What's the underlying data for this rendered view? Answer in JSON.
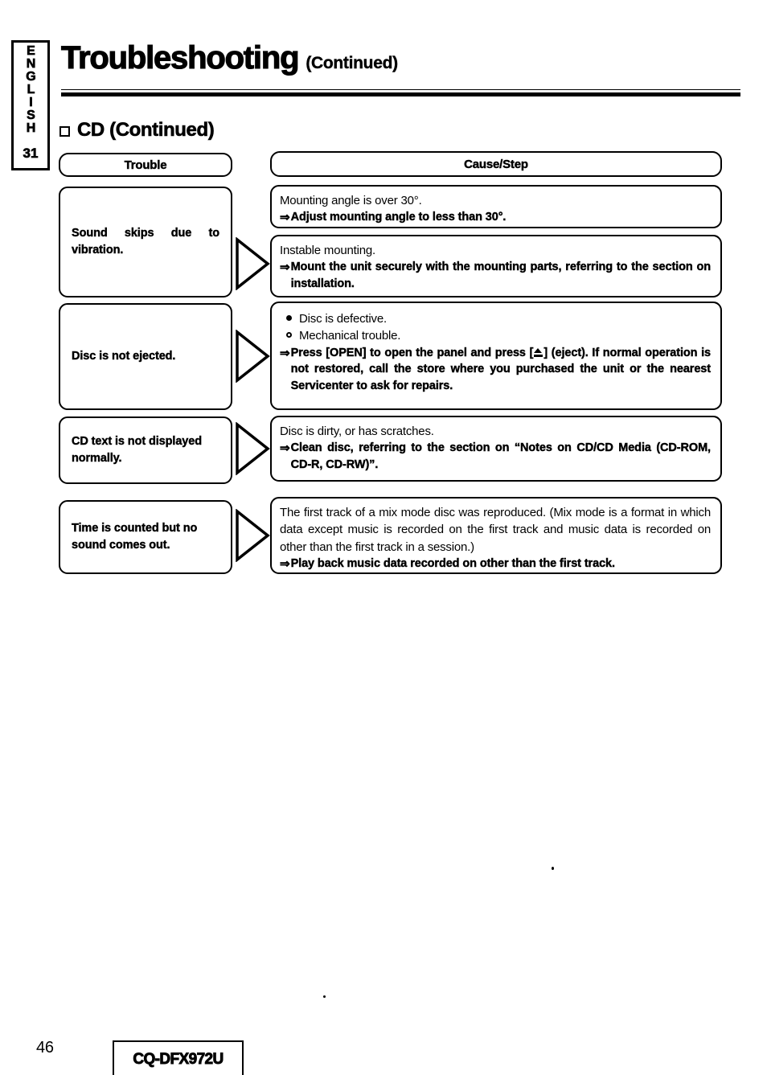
{
  "sidebar": {
    "language_tab": "ENGLISH",
    "tab_number": "31"
  },
  "header": {
    "title": "Troubleshooting",
    "title_suffix": "(Continued)"
  },
  "section": {
    "bullet_icon": "open-square-bullet",
    "heading": "CD (Continued)"
  },
  "table": {
    "columns": {
      "trouble": "Trouble",
      "cause_step": "Cause/Step"
    },
    "rows": [
      {
        "trouble": "Sound skips due to vibration.",
        "arrow_icon": "triangle-right-icon",
        "causes": [
          {
            "lines": [
              {
                "style": "plain",
                "text": "Mounting angle is over 30°."
              }
            ],
            "steps": [
              {
                "arrow": "⇒",
                "text": "Adjust mounting angle to less than 30°."
              }
            ]
          },
          {
            "lines": [
              {
                "style": "plain",
                "text": "Instable mounting."
              }
            ],
            "steps": [
              {
                "arrow": "⇒",
                "text": "Mount the unit securely with the mounting parts, referring to the section on installation."
              }
            ]
          }
        ]
      },
      {
        "trouble": "Disc is not ejected.",
        "arrow_icon": "triangle-right-icon",
        "causes": [
          {
            "bullets": [
              {
                "marker": "filled-ring",
                "text": "Disc is defective."
              },
              {
                "marker": "open-ring",
                "text": "Mechanical trouble."
              }
            ],
            "steps": [
              {
                "arrow": "⇒",
                "text_before_symbol": "Press [OPEN] to open the panel and press [",
                "symbol_icon": "eject-icon",
                "text_after_symbol": "] (eject). If normal operation is not restored, call the store where you purchased the unit or the nearest Servicenter to ask for repairs."
              }
            ]
          }
        ]
      },
      {
        "trouble": "CD text is not displayed normally.",
        "arrow_icon": "triangle-right-icon",
        "causes": [
          {
            "lines": [
              {
                "style": "plain",
                "text": "Disc is dirty, or has scratches."
              }
            ],
            "steps": [
              {
                "arrow": "⇒",
                "text": "Clean disc, referring to the section on “Notes on CD/CD Media (CD-ROM, CD-R, CD-RW)”."
              }
            ]
          }
        ]
      },
      {
        "trouble": "Time is counted but no sound comes out.",
        "arrow_icon": "triangle-right-icon",
        "causes": [
          {
            "lines": [
              {
                "style": "plain",
                "text": "The first track of a mix mode disc was reproduced. (Mix mode is a format in which data except music is recorded on the first track and music data is recorded on other than the first track in a session.)"
              }
            ],
            "steps": [
              {
                "arrow": "⇒",
                "text": "Play back music data recorded on other than the first track."
              }
            ]
          }
        ]
      }
    ]
  },
  "footer": {
    "page_number": "46",
    "model": "CQ-DFX972U"
  }
}
